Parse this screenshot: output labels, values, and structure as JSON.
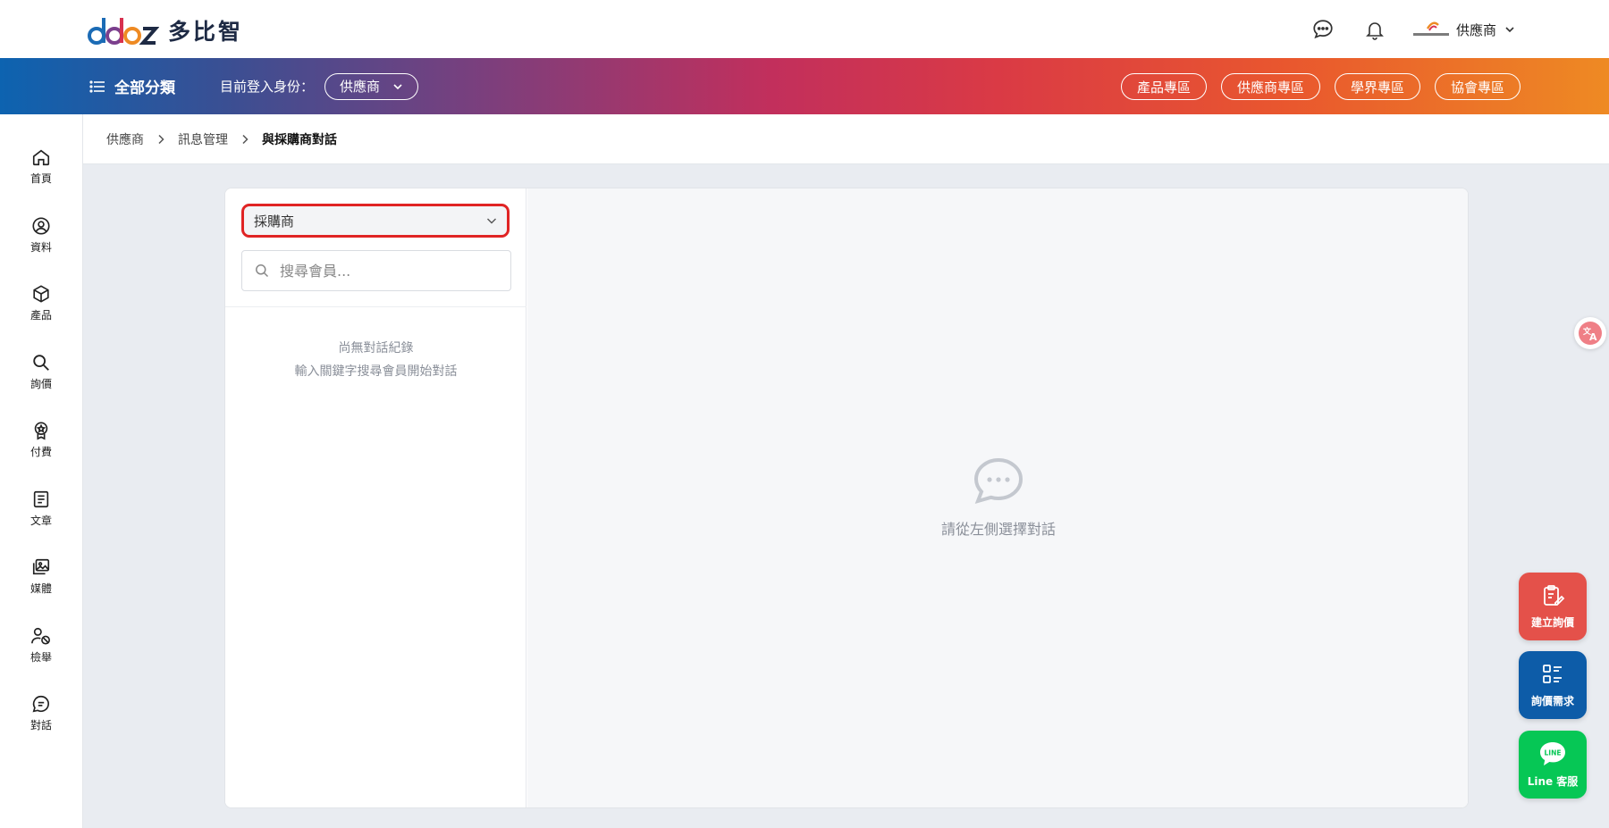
{
  "header": {
    "logo_text": "多比智",
    "user_name": "供應商"
  },
  "navbar": {
    "all_categories": "全部分類",
    "identity_label": "目前登入身份：",
    "identity_value": "供應商",
    "links": [
      {
        "label": "產品專區"
      },
      {
        "label": "供應商專區"
      },
      {
        "label": "學界專區"
      },
      {
        "label": "協會專區"
      }
    ]
  },
  "sidebar": {
    "items": [
      {
        "label": "首頁",
        "icon": "home-icon"
      },
      {
        "label": "資料",
        "icon": "user-circle-icon"
      },
      {
        "label": "產品",
        "icon": "box-icon"
      },
      {
        "label": "詢價",
        "icon": "search-icon"
      },
      {
        "label": "付費",
        "icon": "award-icon"
      },
      {
        "label": "文章",
        "icon": "document-icon"
      },
      {
        "label": "媒體",
        "icon": "media-icon"
      },
      {
        "label": "檢舉",
        "icon": "report-user-icon"
      },
      {
        "label": "對話",
        "icon": "chat-icon"
      }
    ]
  },
  "breadcrumb": {
    "items": [
      "供應商",
      "訊息管理",
      "與採購商對話"
    ]
  },
  "chat": {
    "role_select": "採購商",
    "search_placeholder": "搜尋會員...",
    "empty_line1": "尚無對話紀錄",
    "empty_line2": "輸入關鍵字搜尋會員開始對話",
    "placeholder": "請從左側選擇對話"
  },
  "fabs": {
    "create_rfq": "建立詢價",
    "rfq_list": "詢價需求",
    "line_service": "Line 客服",
    "line_badge": "LINE"
  },
  "colors": {
    "accent_red": "#e02424",
    "fab_red": "#e4514a",
    "fab_blue": "#0d5ca8",
    "fab_green": "#06c755"
  }
}
